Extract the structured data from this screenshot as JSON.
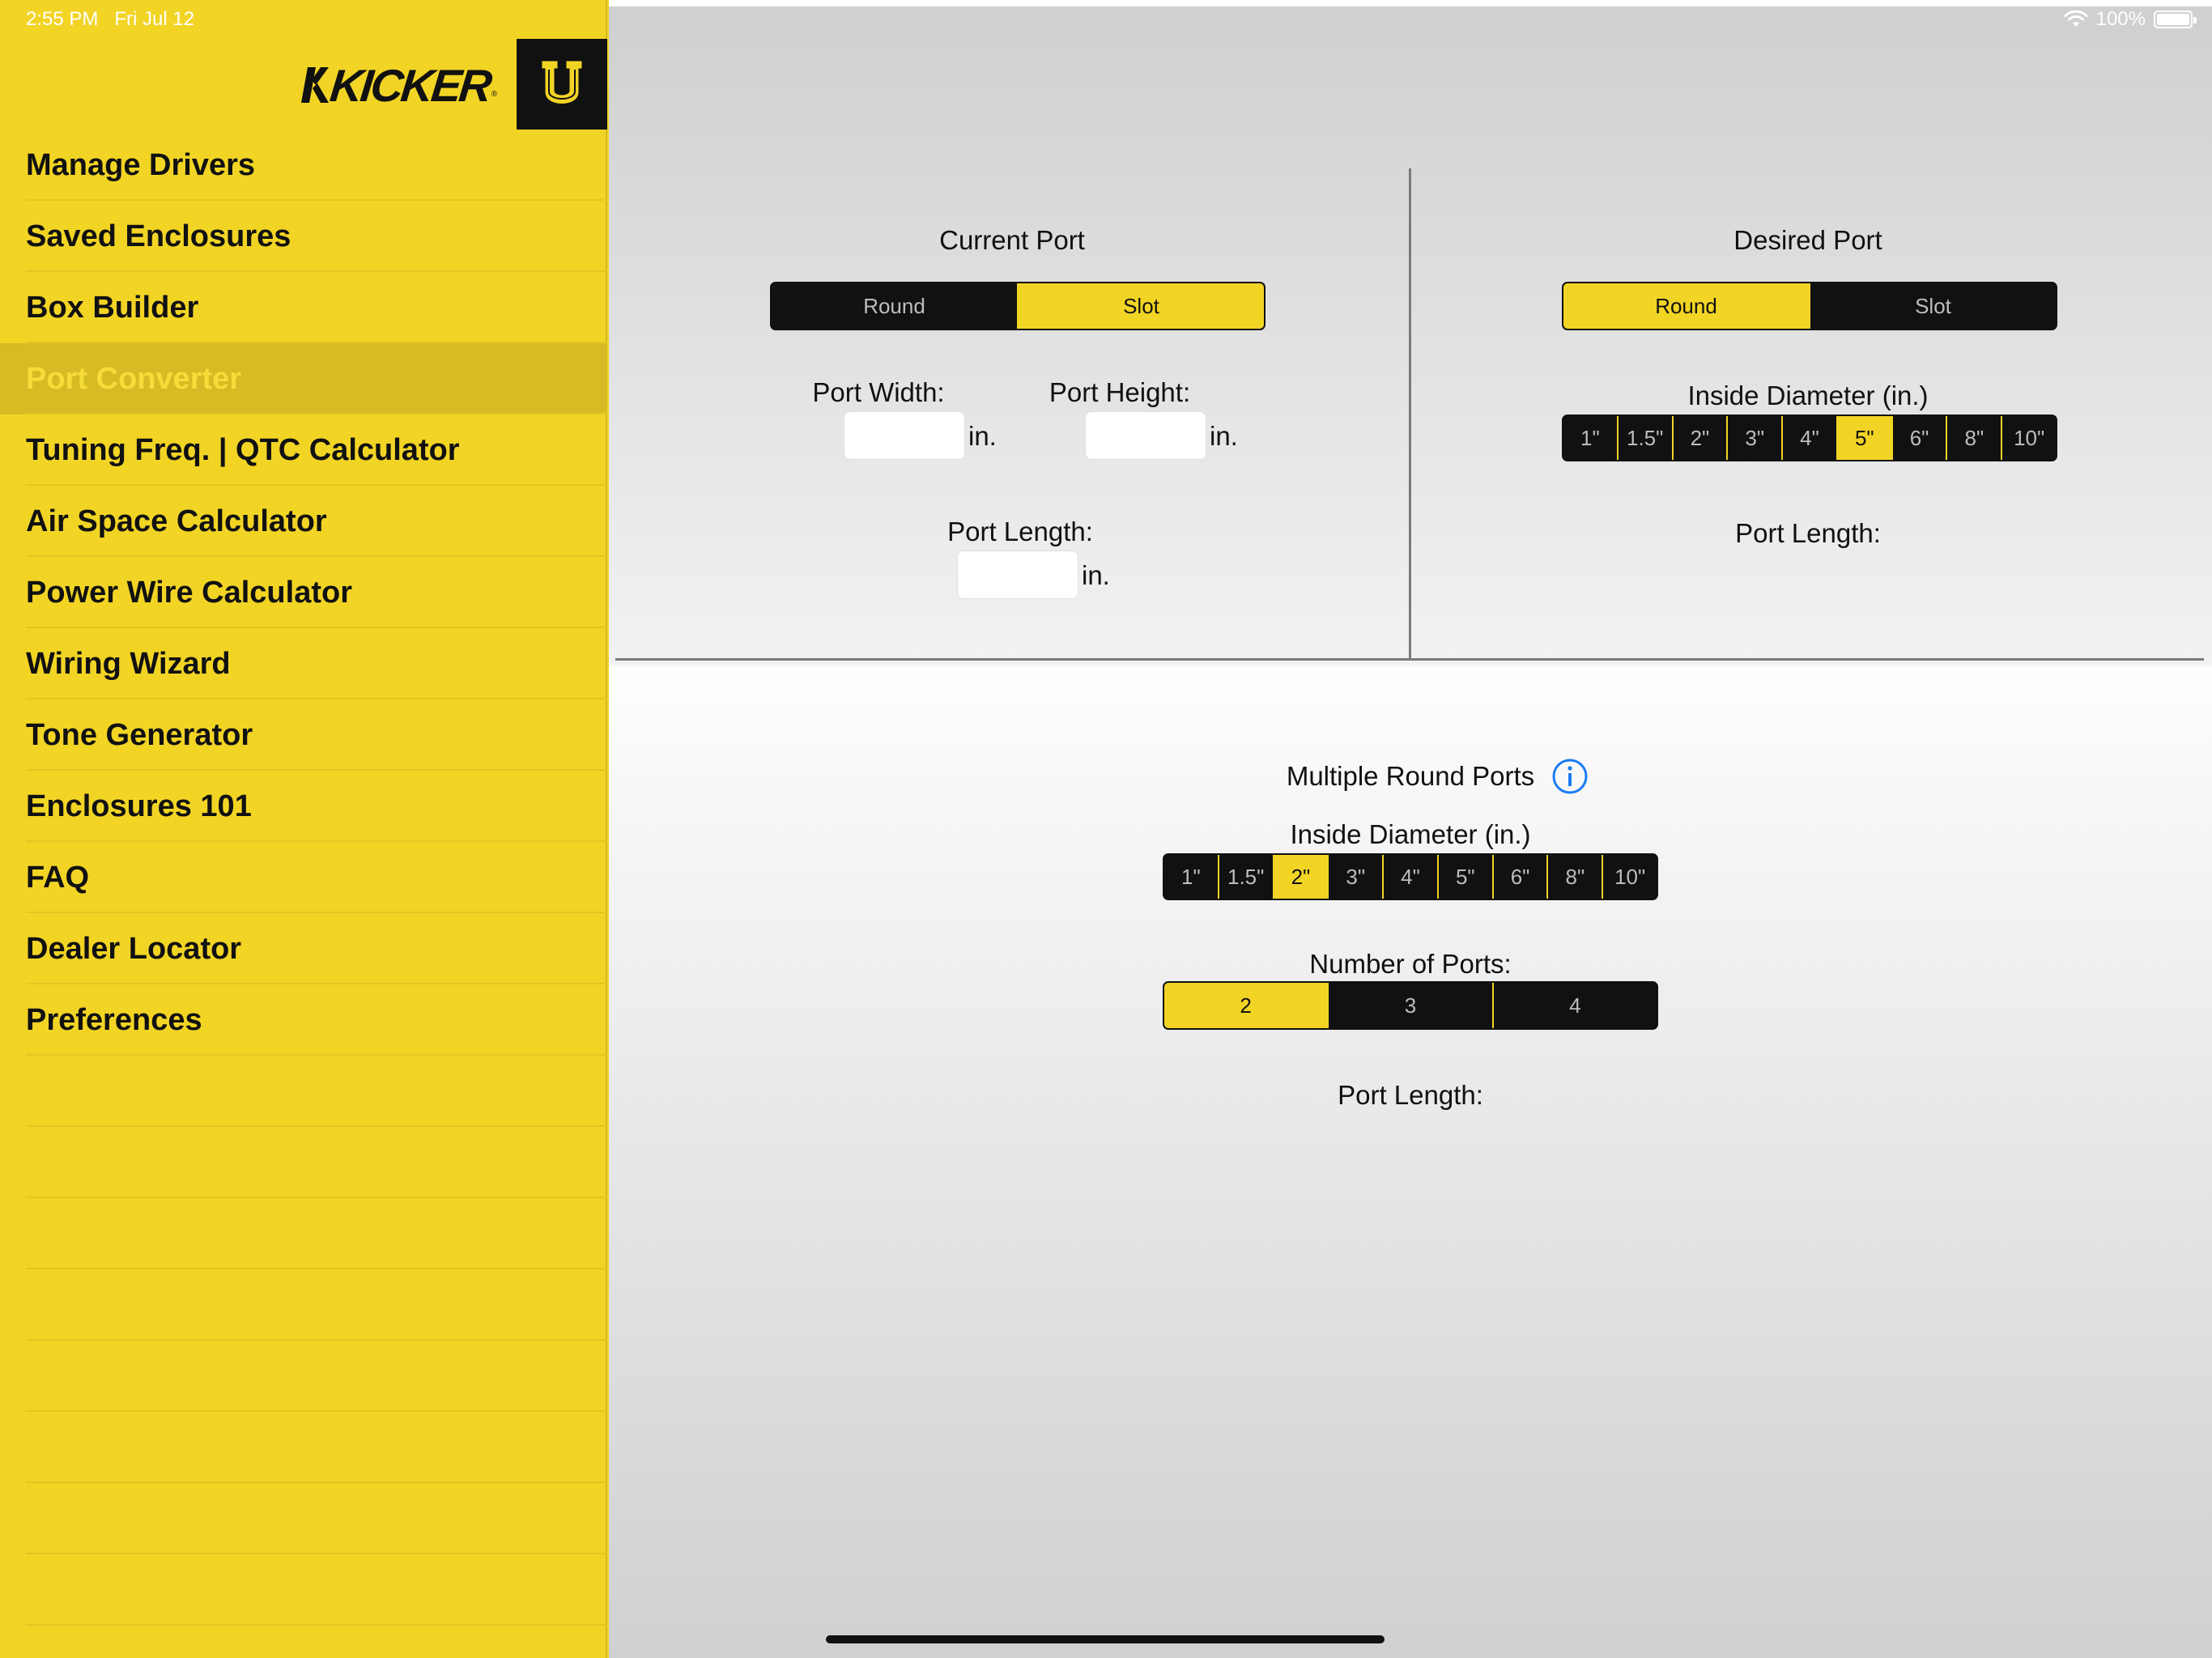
{
  "status_bar": {
    "time": "2:55 PM",
    "date": "Fri Jul 12",
    "battery": "100%"
  },
  "brand": {
    "logo_text": "KICKER",
    "badge_letter": "U"
  },
  "sidebar": {
    "items": [
      {
        "label": "Manage Drivers",
        "active": false
      },
      {
        "label": "Saved Enclosures",
        "active": false
      },
      {
        "label": "Box Builder",
        "active": false
      },
      {
        "label": "Port Converter",
        "active": true
      },
      {
        "label": "Tuning Freq. | QTC Calculator",
        "active": false
      },
      {
        "label": "Air Space Calculator",
        "active": false
      },
      {
        "label": "Power Wire Calculator",
        "active": false
      },
      {
        "label": "Wiring Wizard",
        "active": false
      },
      {
        "label": "Tone Generator",
        "active": false
      },
      {
        "label": "Enclosures 101",
        "active": false
      },
      {
        "label": "FAQ",
        "active": false
      },
      {
        "label": "Dealer Locator",
        "active": false
      },
      {
        "label": "Preferences",
        "active": false
      }
    ]
  },
  "current_port": {
    "title": "Current Port",
    "type_options": [
      "Round",
      "Slot"
    ],
    "selected_type": "Slot",
    "width_label": "Port Width:",
    "height_label": "Port Height:",
    "length_label": "Port Length:",
    "unit": "in.",
    "width_value": "",
    "height_value": "",
    "length_value": ""
  },
  "desired_port": {
    "title": "Desired Port",
    "type_options": [
      "Round",
      "Slot"
    ],
    "selected_type": "Round",
    "diameter_label": "Inside Diameter (in.)",
    "diameter_options": [
      "1\"",
      "1.5\"",
      "2\"",
      "3\"",
      "4\"",
      "5\"",
      "6\"",
      "8\"",
      "10\""
    ],
    "selected_diameter": "5\"",
    "length_label": "Port Length:"
  },
  "multiple_ports": {
    "title": "Multiple Round Ports",
    "info_icon": "info-icon",
    "diameter_label": "Inside Diameter (in.)",
    "diameter_options": [
      "1\"",
      "1.5\"",
      "2\"",
      "3\"",
      "4\"",
      "5\"",
      "6\"",
      "8\"",
      "10\""
    ],
    "selected_diameter": "2\"",
    "count_label": "Number of Ports:",
    "count_options": [
      "2",
      "3",
      "4"
    ],
    "selected_count": "2",
    "length_label": "Port Length:"
  },
  "colors": {
    "accent": "#f2d425",
    "active_item_bg": "#d6bb24",
    "control_dark": "#111111",
    "info_blue": "#1a7cf2"
  }
}
